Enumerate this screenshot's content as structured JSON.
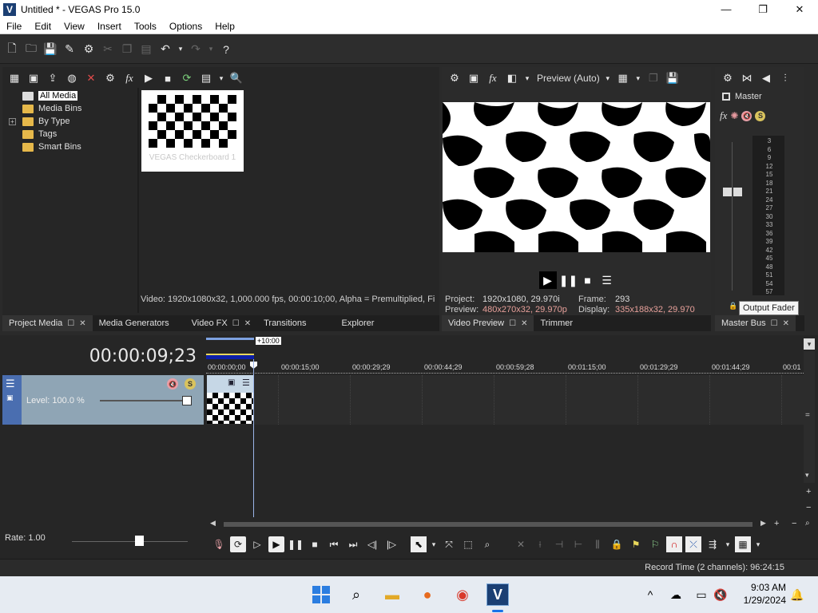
{
  "window": {
    "title": "Untitled * - VEGAS Pro 15.0",
    "app_icon_letter": "V",
    "minimize": "—",
    "maximize": "❐",
    "close": "✕"
  },
  "menu": [
    "File",
    "Edit",
    "View",
    "Insert",
    "Tools",
    "Options",
    "Help"
  ],
  "toolbar_icons": [
    "new-icon",
    "open-icon",
    "save-icon",
    "save-as-icon",
    "properties-icon",
    "cut-icon",
    "copy-icon",
    "paste-icon",
    "undo-icon",
    "redo-icon",
    "help-icon"
  ],
  "project_media": {
    "tree": [
      {
        "label": "All Media",
        "selected": true
      },
      {
        "label": "Media Bins"
      },
      {
        "label": "By Type",
        "expandable": true,
        "expander": "+"
      },
      {
        "label": "Tags"
      },
      {
        "label": "Smart Bins"
      }
    ],
    "item_label": "VEGAS Checkerboard 1",
    "status": "Video: 1920x1080x32, 1,000.000 fps, 00:00:10;00, Alpha = Premultiplied, Fi"
  },
  "left_tabs": [
    "Project Media",
    "Media Generators",
    "Video FX",
    "Transitions",
    "Explorer"
  ],
  "preview": {
    "mode": "Preview (Auto)",
    "project_label": "Project:",
    "project_value": "1920x1080, 29.970i",
    "preview_label": "Preview:",
    "preview_value": "480x270x32, 29.970p",
    "frame_label": "Frame:",
    "frame_value": "293",
    "display_label": "Display:",
    "display_value": "335x188x32, 29.970"
  },
  "preview_tabs": [
    "Video Preview",
    "Trimmer"
  ],
  "master": {
    "label": "Master",
    "scale": [
      "3",
      "6",
      "9",
      "12",
      "15",
      "18",
      "21",
      "24",
      "27",
      "30",
      "33",
      "36",
      "39",
      "42",
      "45",
      "48",
      "51",
      "54",
      "57"
    ],
    "tooltip": "Output Fader",
    "tab": "Master Bus"
  },
  "timeline": {
    "timecode": "00:00:09;23",
    "region_label": "+10:00",
    "track_level": "Level: 100.0 %",
    "ruler": [
      "00:00:00;00",
      "00:00:15;00",
      "00:00:29;29",
      "00:00:44;29",
      "00:00:59;28",
      "00:01:15;00",
      "00:01:29;29",
      "00:01:44;29",
      "00:01"
    ],
    "rate": "Rate: 1.00"
  },
  "status_bar": {
    "record_time": "Record Time (2 channels): 96:24:15"
  },
  "taskbar": {
    "time": "9:03 AM",
    "date": "1/29/2024"
  }
}
